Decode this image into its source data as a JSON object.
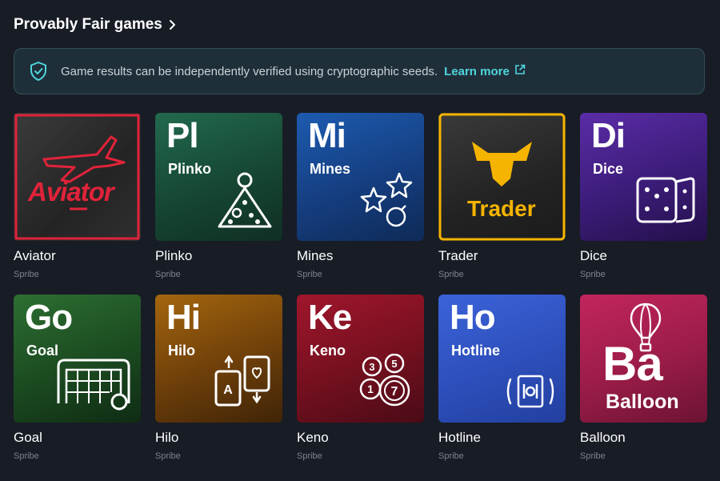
{
  "header": {
    "title": "Provably Fair games",
    "chevron_icon": "chevron-right-icon"
  },
  "banner": {
    "icon": "shield-check-icon",
    "message": "Game results can be independently verified using cryptographic seeds.",
    "link_label": "Learn more",
    "link_icon": "external-link-icon"
  },
  "colors": {
    "background": "#181c25",
    "accent": "#4fd6dc",
    "provider_text": "#7c8490",
    "aviator_red": "#e0233a",
    "trader_yellow": "#f5b400"
  },
  "games": [
    {
      "title": "Aviator",
      "provider": "Spribe",
      "tile_logo": "Aviator"
    },
    {
      "title": "Plinko",
      "provider": "Spribe",
      "abbr": "Pl",
      "tile_name": "Plinko"
    },
    {
      "title": "Mines",
      "provider": "Spribe",
      "abbr": "Mi",
      "tile_name": "Mines"
    },
    {
      "title": "Trader",
      "provider": "Spribe",
      "tile_logo": "Trader"
    },
    {
      "title": "Dice",
      "provider": "Spribe",
      "abbr": "Di",
      "tile_name": "Dice"
    },
    {
      "title": "Goal",
      "provider": "Spribe",
      "abbr": "Go",
      "tile_name": "Goal"
    },
    {
      "title": "Hilo",
      "provider": "Spribe",
      "abbr": "Hi",
      "tile_name": "Hilo"
    },
    {
      "title": "Keno",
      "provider": "Spribe",
      "abbr": "Ke",
      "tile_name": "Keno"
    },
    {
      "title": "Hotline",
      "provider": "Spribe",
      "abbr": "Ho",
      "tile_name": "Hotline"
    },
    {
      "title": "Balloon",
      "provider": "Spribe",
      "abbr": "Ba",
      "tile_name": "Balloon"
    }
  ],
  "keno_balls": [
    "3",
    "5",
    "1",
    "7"
  ],
  "hilo_card_letter": "A"
}
